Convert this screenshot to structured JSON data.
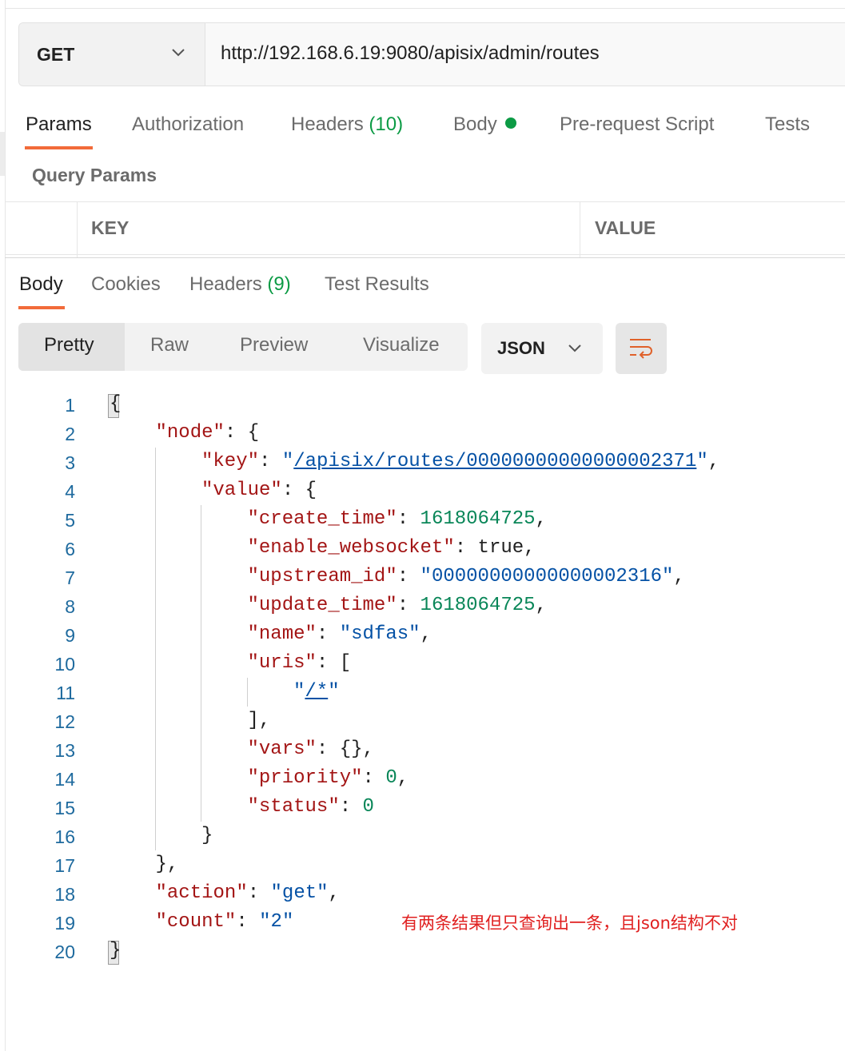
{
  "request": {
    "method": "GET",
    "url": "http://192.168.6.19:9080/apisix/admin/routes"
  },
  "request_tabs": {
    "params": "Params",
    "authorization": "Authorization",
    "headers": "Headers",
    "headers_count": "(10)",
    "body": "Body",
    "pre_request": "Pre-request Script",
    "tests": "Tests"
  },
  "query_params": {
    "title": "Query Params",
    "key_header": "KEY",
    "value_header": "VALUE"
  },
  "response_tabs": {
    "body": "Body",
    "cookies": "Cookies",
    "headers": "Headers",
    "headers_count": "(9)",
    "test_results": "Test Results"
  },
  "view_modes": [
    "Pretty",
    "Raw",
    "Preview",
    "Visualize"
  ],
  "format": "JSON",
  "code_lines": [
    "{",
    "\"node\": {",
    "\"key\": \"/apisix/routes/00000000000000002371\",",
    "\"value\": {",
    "\"create_time\": 1618064725,",
    "\"enable_websocket\": true,",
    "\"upstream_id\": \"00000000000000002316\",",
    "\"update_time\": 1618064725,",
    "\"name\": \"sdfas\",",
    "\"uris\": [",
    "\"/*\"",
    "],",
    "\"vars\": {},",
    "\"priority\": 0,",
    "\"status\": 0",
    "}",
    "},",
    "\"action\": \"get\",",
    "\"count\": \"2\"",
    "}"
  ],
  "annotation": "有两条结果但只查询出一条，且json结构不对",
  "colors": {
    "accent": "#f26b3a",
    "count_green": "#0c9b45",
    "json_key": "#a31515",
    "json_string": "#0451a5",
    "json_number": "#098658",
    "annotation": "#e02020"
  }
}
